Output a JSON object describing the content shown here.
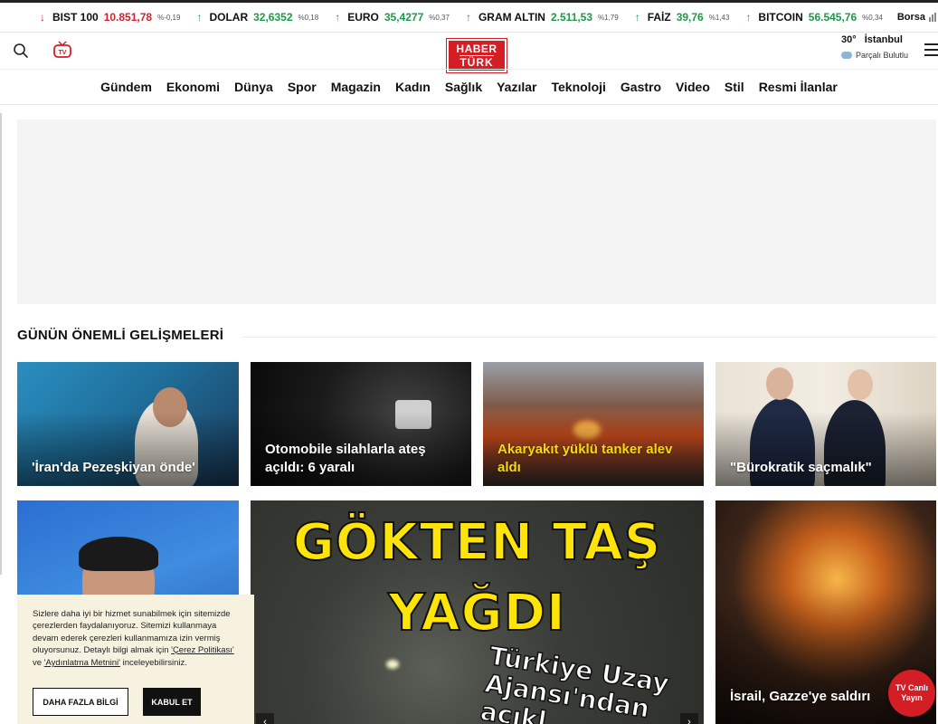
{
  "ticker": [
    {
      "name": "BIST 100",
      "value": "10.851,78",
      "pct": "%-0,19",
      "dir": "down"
    },
    {
      "name": "DOLAR",
      "value": "32,6352",
      "pct": "%0,18",
      "dir": "up"
    },
    {
      "name": "EURO",
      "value": "35,4277",
      "pct": "%0,37",
      "dir": "up"
    },
    {
      "name": "GRAM ALTIN",
      "value": "2.511,53",
      "pct": "%1,79",
      "dir": "up"
    },
    {
      "name": "FAİZ",
      "value": "39,76",
      "pct": "%1,43",
      "dir": "up"
    },
    {
      "name": "BITCOIN",
      "value": "56.545,76",
      "pct": "%0,34",
      "dir": "up"
    }
  ],
  "ticker_borsa": "Borsa",
  "arrows": {
    "up": "↑",
    "down": "↓"
  },
  "logo": {
    "line1": "HABER",
    "line2": "TÜRK",
    "color": "#d41e26"
  },
  "weather": {
    "temp": "30°",
    "city": "İstanbul",
    "condition": "Parçalı Bulutlu"
  },
  "nav": [
    "Gündem",
    "Ekonomi",
    "Dünya",
    "Spor",
    "Magazin",
    "Kadın",
    "Sağlık",
    "Yazılar",
    "Teknoloji",
    "Gastro",
    "Video",
    "Stil",
    "Resmi İlanlar"
  ],
  "section_title": "GÜNÜN ÖNEMLİ GELİŞMELERİ",
  "cards": {
    "c1": "'İran'da Pezeşkiyan önde'",
    "c2": "Otomobile silahlarla ateş açıldı: 6 yaralı",
    "c3": "Akaryakıt yüklü tanker alev aldı",
    "c4": "\"Bürokratik saçmalık\"",
    "c7": "İsrail, Gazze'ye saldırı"
  },
  "headline": {
    "line1": "GÖKTEN TAŞ",
    "line2": "YAĞDI",
    "sub1": "Türkiye Uzay",
    "sub2": "Ajansı'ndan",
    "sub3": "açıkl..."
  },
  "cookie": {
    "text_before": "Sizlere daha iyi bir hizmet sunabilmek için sitemizde çerezlerden faydalanıyoruz. Sitemizi kullanmaya devam ederek çerezleri kullanmamıza izin vermiş oluyorsunuz. Detaylı bilgi almak için ",
    "link1": "'Çerez Politikası'",
    "text_mid": " ve ",
    "link2": "'Aydınlatma Metnini'",
    "text_after": " inceleyebilirsiniz.",
    "more_button": "DAHA FAZLA BİLGİ",
    "ok_button": "KABUL ET"
  },
  "tv_live": "TV Canlı Yayın",
  "tv_badge": "TV",
  "slider_prev": "‹",
  "slider_next": "›"
}
